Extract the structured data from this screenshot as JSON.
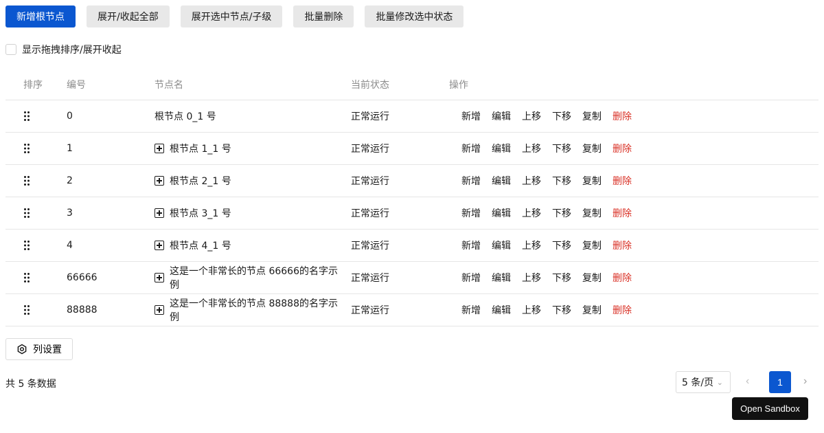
{
  "toolbar": {
    "buttons": [
      {
        "label": "新增根节点",
        "primary": true
      },
      {
        "label": "展开/收起全部",
        "primary": false
      },
      {
        "label": "展开选中节点/子级",
        "primary": false
      },
      {
        "label": "批量删除",
        "primary": false
      },
      {
        "label": "批量修改选中状态",
        "primary": false
      }
    ]
  },
  "options": {
    "checkbox_label": "显示拖拽排序/展开收起"
  },
  "table": {
    "headers": {
      "drag": "排序",
      "id": "编号",
      "name": "节点名",
      "status": "当前状态",
      "ops": "操作"
    },
    "ops": [
      "新增",
      "编辑",
      "上移",
      "下移",
      "复制",
      "删除"
    ],
    "rows": [
      {
        "id": "0",
        "name": "根节点 0_1 号",
        "status": "正常运行",
        "expandable": false
      },
      {
        "id": "1",
        "name": "根节点 1_1 号",
        "status": "正常运行",
        "expandable": true
      },
      {
        "id": "2",
        "name": "根节点 2_1 号",
        "status": "正常运行",
        "expandable": true
      },
      {
        "id": "3",
        "name": "根节点 3_1 号",
        "status": "正常运行",
        "expandable": true
      },
      {
        "id": "4",
        "name": "根节点 4_1 号",
        "status": "正常运行",
        "expandable": true
      },
      {
        "id": "66666",
        "name": "这是一个非常长的节点 66666的名字示例",
        "status": "正常运行",
        "expandable": true
      },
      {
        "id": "88888",
        "name": "这是一个非常长的节点 88888的名字示例",
        "status": "正常运行",
        "expandable": true
      }
    ]
  },
  "settings": {
    "label": "列设置",
    "icon": "gear-icon"
  },
  "pagination": {
    "total_text": "共 5 条数据",
    "page_size": "5 条/页",
    "current_page": "1"
  },
  "sandbox": {
    "label": "Open Sandbox"
  },
  "colors": {
    "primary": "#0b57d0",
    "danger": "#d93025"
  }
}
